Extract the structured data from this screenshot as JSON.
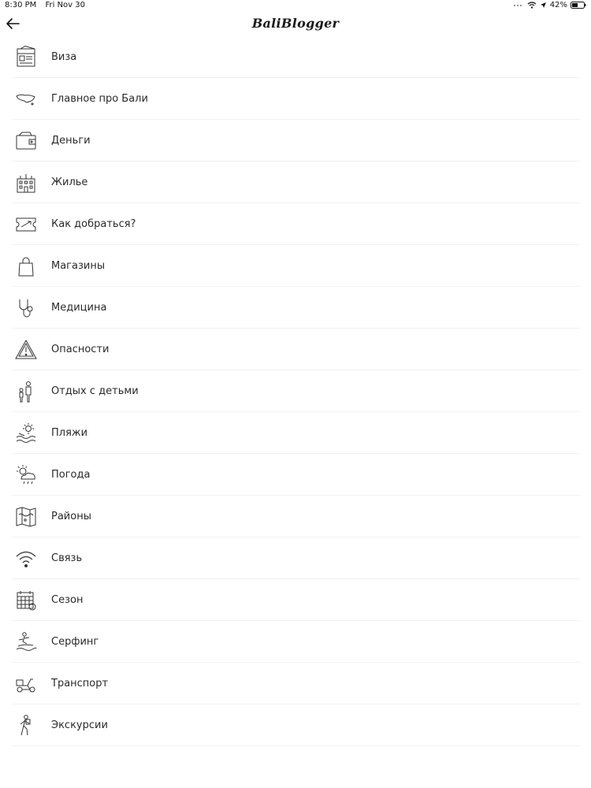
{
  "status": {
    "time": "8:30 PM",
    "date": "Fri Nov 30",
    "battery": "42%"
  },
  "nav": {
    "title": "BaliBlogger"
  },
  "menu": [
    {
      "label": "Виза",
      "icon": "visa-icon"
    },
    {
      "label": "Главное про Бали",
      "icon": "bali-island-icon"
    },
    {
      "label": "Деньги",
      "icon": "wallet-icon"
    },
    {
      "label": "Жилье",
      "icon": "hotel-icon"
    },
    {
      "label": "Как добраться?",
      "icon": "plane-ticket-icon"
    },
    {
      "label": "Магазины",
      "icon": "shopping-bag-icon"
    },
    {
      "label": "Медицина",
      "icon": "stethoscope-icon"
    },
    {
      "label": "Опасности",
      "icon": "warning-icon"
    },
    {
      "label": "Отдых с детьми",
      "icon": "family-icon"
    },
    {
      "label": "Пляжи",
      "icon": "beach-icon"
    },
    {
      "label": "Погода",
      "icon": "weather-icon"
    },
    {
      "label": "Районы",
      "icon": "map-icon"
    },
    {
      "label": "Связь",
      "icon": "wifi-icon"
    },
    {
      "label": "Сезон",
      "icon": "calendar-icon"
    },
    {
      "label": "Серфинг",
      "icon": "surfer-icon"
    },
    {
      "label": "Транспорт",
      "icon": "scooter-icon"
    },
    {
      "label": "Экскурсии",
      "icon": "hiker-icon"
    }
  ]
}
